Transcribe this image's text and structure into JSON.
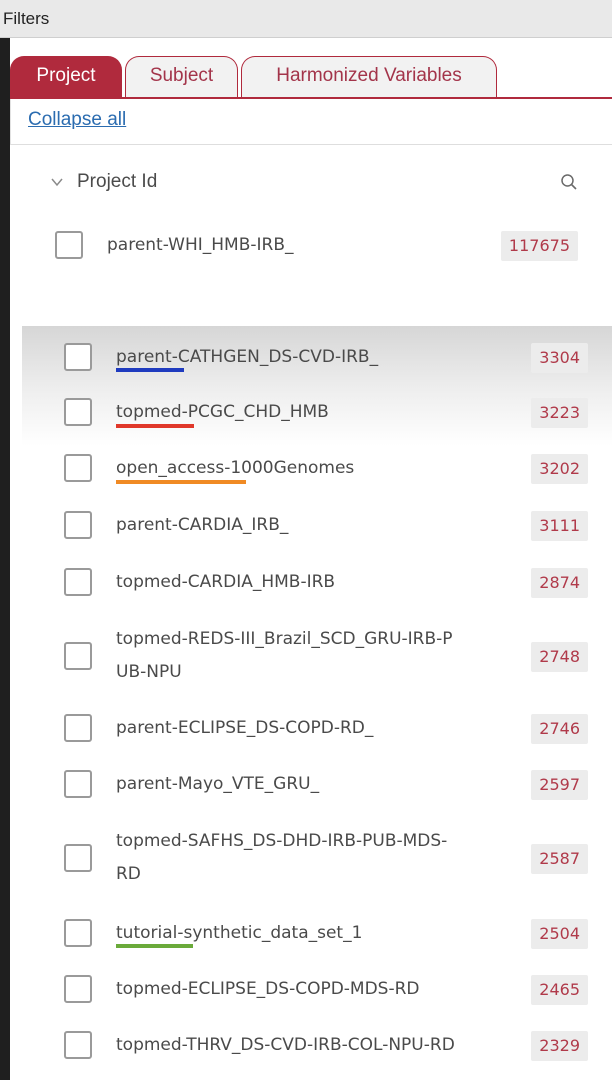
{
  "window": {
    "title": "Filters"
  },
  "tabs": [
    {
      "label": "Project",
      "active": true
    },
    {
      "label": "Subject",
      "active": false
    },
    {
      "label": "Harmonized Variables",
      "active": false
    }
  ],
  "collapse_all": "Collapse all",
  "field": {
    "label": "Project Id",
    "expanded": true
  },
  "colors": {
    "accent": "#b02a3d",
    "link": "#2b6cb0",
    "underline_parent": "#1f3bbf",
    "underline_topmed": "#e0382a",
    "underline_open_access": "#f08a24",
    "underline_tutorial": "#6aaa3a"
  },
  "items": [
    {
      "name": "parent-WHI_HMB-IRB_",
      "count": "117675",
      "checked": false
    },
    {
      "name": "parent-CATHGEN_DS-CVD-IRB_",
      "count": "3304",
      "checked": false,
      "underlined_prefix": "parent"
    },
    {
      "name": "topmed-PCGC_CHD_HMB",
      "count": "3223",
      "checked": false,
      "underlined_prefix": "topmed"
    },
    {
      "name": "open_access-1000Genomes",
      "count": "3202",
      "checked": false,
      "underlined_prefix": "open_access"
    },
    {
      "name": "parent-CARDIA_IRB_",
      "count": "3111",
      "checked": false
    },
    {
      "name": "topmed-CARDIA_HMB-IRB",
      "count": "2874",
      "checked": false
    },
    {
      "name_line1": "topmed-REDS-III_Brazil_SCD_GRU-IRB-P",
      "name_line2": "UB-NPU",
      "count": "2748",
      "checked": false
    },
    {
      "name": "parent-ECLIPSE_DS-COPD-RD_",
      "count": "2746",
      "checked": false
    },
    {
      "name": "parent-Mayo_VTE_GRU_",
      "count": "2597",
      "checked": false
    },
    {
      "name_line1": "topmed-SAFHS_DS-DHD-IRB-PUB-MDS-",
      "name_line2": "RD",
      "count": "2587",
      "checked": false
    },
    {
      "name": "tutorial-synthetic_data_set_1",
      "count": "2504",
      "checked": false,
      "underlined_prefix": "tutorial"
    },
    {
      "name": "topmed-ECLIPSE_DS-COPD-MDS-RD",
      "count": "2465",
      "checked": false
    },
    {
      "name": "topmed-THRV_DS-CVD-IRB-COL-NPU-RD",
      "count": "2329",
      "checked": false
    }
  ]
}
